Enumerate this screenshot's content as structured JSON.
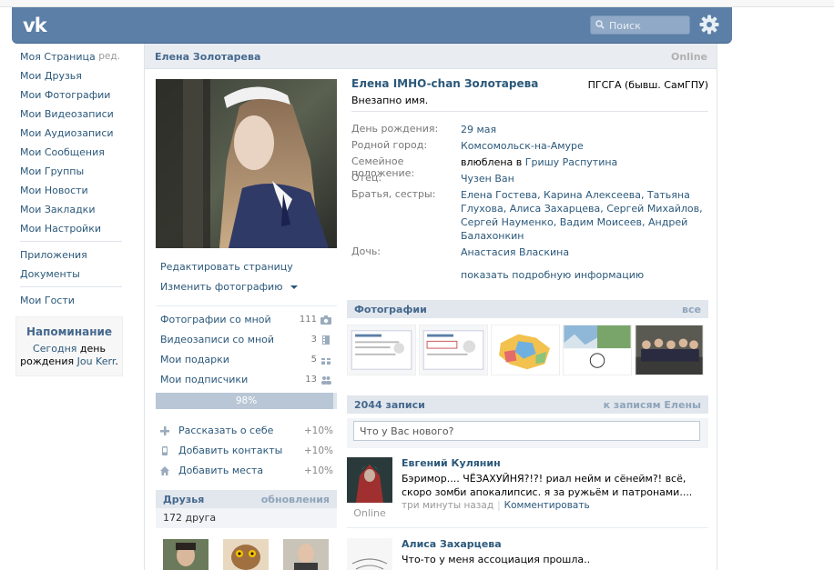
{
  "header": {
    "logo": "vk",
    "search_placeholder": "Поиск"
  },
  "nav": {
    "items": [
      {
        "label": "Моя Страница",
        "edit": "ред."
      },
      {
        "label": "Мои Друзья"
      },
      {
        "label": "Мои Фотографии"
      },
      {
        "label": "Мои Видеозаписи"
      },
      {
        "label": "Мои Аудиозаписи"
      },
      {
        "label": "Мои Сообщения"
      },
      {
        "label": "Мои Группы"
      },
      {
        "label": "Мои Новости"
      },
      {
        "label": "Мои Закладки"
      },
      {
        "label": "Мои Настройки"
      }
    ],
    "extra": [
      {
        "label": "Приложения"
      },
      {
        "label": "Документы"
      }
    ],
    "guests": "Мои Гости"
  },
  "reminder": {
    "title": "Напоминание",
    "today": "Сегодня",
    "text1": " день рождения ",
    "person": "Jou Kerr",
    "dot": "."
  },
  "profile": {
    "header_name": "Елена Золотарева",
    "online": "Online",
    "full_name": "Елена IMHO-chan Золотарева",
    "university": "ПГСГА (бывш. СамГПУ)",
    "status": "Внезапно имя.",
    "info": [
      {
        "key": "День рождения:",
        "value": "29 мая"
      },
      {
        "key": "Родной город:",
        "value": "Комсомольск-на-Амуре"
      },
      {
        "key": "Семейное положение:",
        "value_prefix": "влюблена в ",
        "value": "Гришу Распутина"
      },
      {
        "key": "Отец:",
        "value": "Чузен Ван"
      },
      {
        "key": "Братья, сестры:",
        "value": "Елена Гостева, Карина Алексеева, Татьяна Глухова, Алиса Захарцева, Сергей Михайлов, Сергей Науменко, Вадим Моисеев, Андрей Балахонкин"
      },
      {
        "key": "Дочь:",
        "value": "Анастасия Власкина"
      }
    ],
    "show_more": "показать подробную информацию"
  },
  "actions": {
    "edit_page": "Редактировать страницу",
    "change_photo": "Изменить фотографию"
  },
  "counters": [
    {
      "label": "Фотографии со мной",
      "count": "111",
      "icon": "camera-icon"
    },
    {
      "label": "Видеозаписи со мной",
      "count": "3",
      "icon": "film-icon"
    },
    {
      "label": "Мои подарки",
      "count": "5",
      "icon": "gift-icon"
    },
    {
      "label": "Мои подписчики",
      "count": "13",
      "icon": "people-icon"
    }
  ],
  "progress": {
    "value": 0.98,
    "label": "98%"
  },
  "completion": [
    {
      "label": "Рассказать о себе",
      "percent": "+10%",
      "icon": "plus-icon"
    },
    {
      "label": "Добавить контакты",
      "percent": "+10%",
      "icon": "phone-icon"
    },
    {
      "label": "Добавить места",
      "percent": "+10%",
      "icon": "house-icon"
    }
  ],
  "friends": {
    "title": "Друзья",
    "updates": "обновления",
    "count": "172 друга"
  },
  "photos": {
    "title": "Фотографии",
    "all": "все"
  },
  "wall": {
    "title": "2044 записи",
    "link": "к записям Елены",
    "placeholder": "Что у Вас нового?",
    "posts": [
      {
        "author": "Евгений Кулянин",
        "text": "Бэримор.... ЧЁЗАХУЙНЯ?!?! риал нейм и сёнейм?! всё, скоро зомби апокалипсис. я за ружьём и патронами....",
        "time": "три минуты назад",
        "comment": "Комментировать",
        "online": "Online"
      },
      {
        "author": "Алиса Захарцева",
        "text": "Что-то у меня ассоциация прошла.."
      }
    ]
  },
  "colors": {
    "header": "#5b7fa6",
    "link": "#2b587a",
    "section_header": "#e1e7ed"
  }
}
